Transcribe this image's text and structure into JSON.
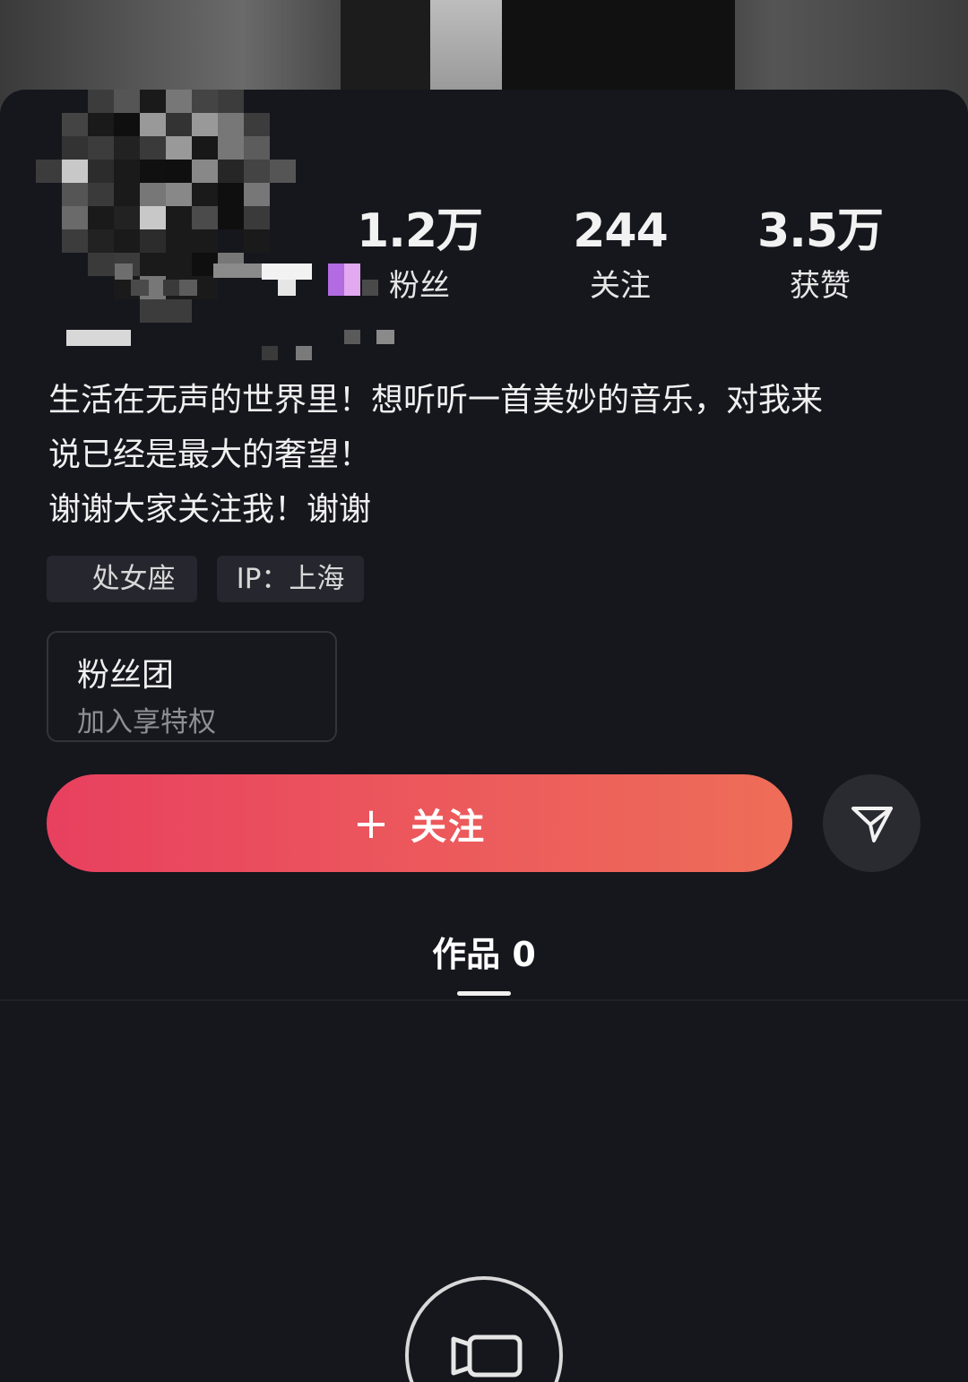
{
  "stats": [
    {
      "value": "1.2万",
      "label": "粉丝"
    },
    {
      "value": "244",
      "label": "关注"
    },
    {
      "value": "3.5万",
      "label": "获赞"
    }
  ],
  "bio": {
    "line1": "生活在无声的世界里！想听听一首美妙的音乐，对我来",
    "line2": "说已经是最大的奢望！",
    "line3": "谢谢大家关注我！谢谢"
  },
  "tags": {
    "zodiac": "处女座",
    "ip": "IP：上海"
  },
  "fan_club": {
    "title": "粉丝团",
    "subtitle": "加入享特权"
  },
  "actions": {
    "follow_plus": "+",
    "follow_label": "关注",
    "share_icon": "paper-plane-icon"
  },
  "tabs": {
    "works_label": "作品 0"
  },
  "empty_state": {
    "icon": "video-camera-icon"
  },
  "colors": {
    "background": "#16161d",
    "follow_gradient_start": "#e8405f",
    "follow_gradient_end": "#ee6d58"
  }
}
